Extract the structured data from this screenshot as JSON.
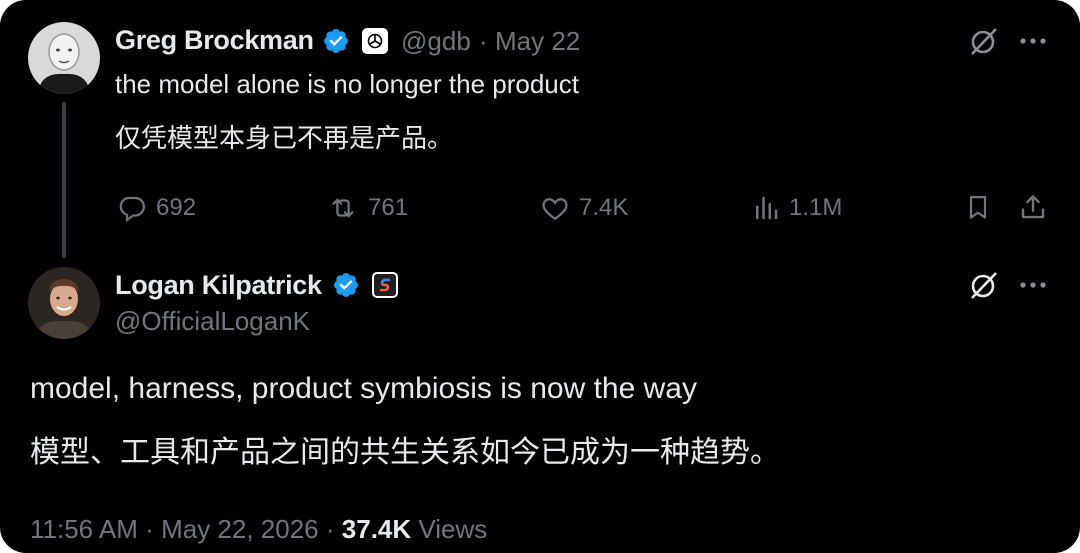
{
  "tweet1": {
    "name": "Greg Brockman",
    "handle": "@gdb",
    "separator": "·",
    "date": "May 22",
    "text_en": "the model alone is no longer the product",
    "text_zh": "仅凭模型本身已不再是产品。",
    "affiliate_icon": "openai-logo-icon",
    "actions": {
      "replies": "692",
      "reposts": "761",
      "likes": "7.4K",
      "views": "1.1M"
    }
  },
  "tweet2": {
    "name": "Logan Kilpatrick",
    "handle": "@OfficialLoganK",
    "affiliate_icon": "google-ai-studio-icon",
    "text_en": "model, harness, product symbiosis is now the way",
    "text_zh": "模型、工具和产品之间的共生关系如今已成为一种趋势。"
  },
  "footer": {
    "time": "11:56 AM",
    "sep1": "·",
    "date": "May 22, 2026",
    "sep2": "·",
    "views_count": "37.4K",
    "views_label": "Views"
  },
  "colors": {
    "background": "#000000",
    "text": "#e7e9ea",
    "muted": "#71767b",
    "verified": "#1d9bf0"
  }
}
